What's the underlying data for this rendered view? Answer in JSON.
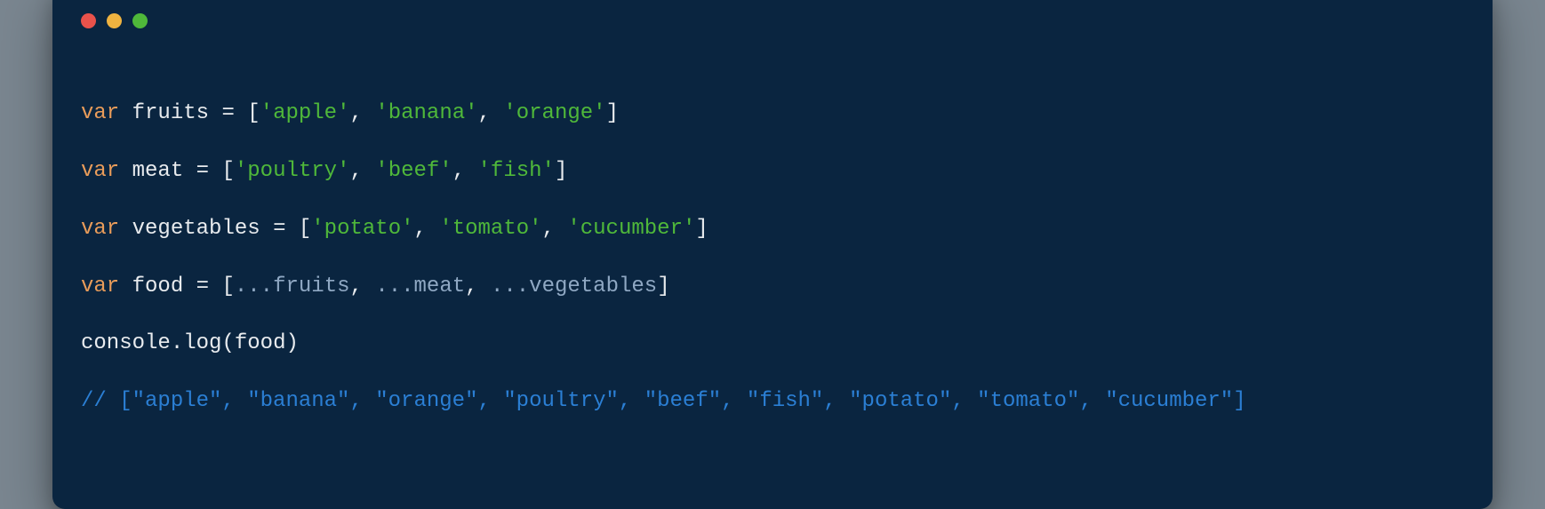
{
  "traffic": {
    "red": "#e9524b",
    "yellow": "#efb340",
    "green": "#4fb83a"
  },
  "code": {
    "line1": {
      "kw": "var",
      "ident": "fruits",
      "eq": "=",
      "open": "[",
      "s1": "'apple'",
      "c1": ", ",
      "s2": "'banana'",
      "c2": ", ",
      "s3": "'orange'",
      "close": "]"
    },
    "line2": {
      "kw": "var",
      "ident": "meat",
      "eq": "=",
      "open": "[",
      "s1": "'poultry'",
      "c1": ", ",
      "s2": "'beef'",
      "c2": ", ",
      "s3": "'fish'",
      "close": "]"
    },
    "line3": {
      "kw": "var",
      "ident": "vegetables",
      "eq": "=",
      "open": "[",
      "s1": "'potato'",
      "c1": ", ",
      "s2": "'tomato'",
      "c2": ", ",
      "s3": "'cucumber'",
      "close": "]"
    },
    "line4": {
      "kw": "var",
      "ident": "food",
      "eq": "=",
      "open": "[",
      "sp1": "...",
      "n1": "fruits",
      "c1": ", ",
      "sp2": "...",
      "n2": "meat",
      "c2": ", ",
      "sp3": "...",
      "n3": "vegetables",
      "close": "]"
    },
    "line5": {
      "obj": "console",
      "dot": ".",
      "fn": "log",
      "open": "(",
      "arg": "food",
      "close": ")"
    },
    "line6": {
      "comment": "// [\"apple\", \"banana\", \"orange\", \"poultry\", \"beef\", \"fish\", \"potato\", \"tomato\", \"cucumber\"]"
    }
  }
}
